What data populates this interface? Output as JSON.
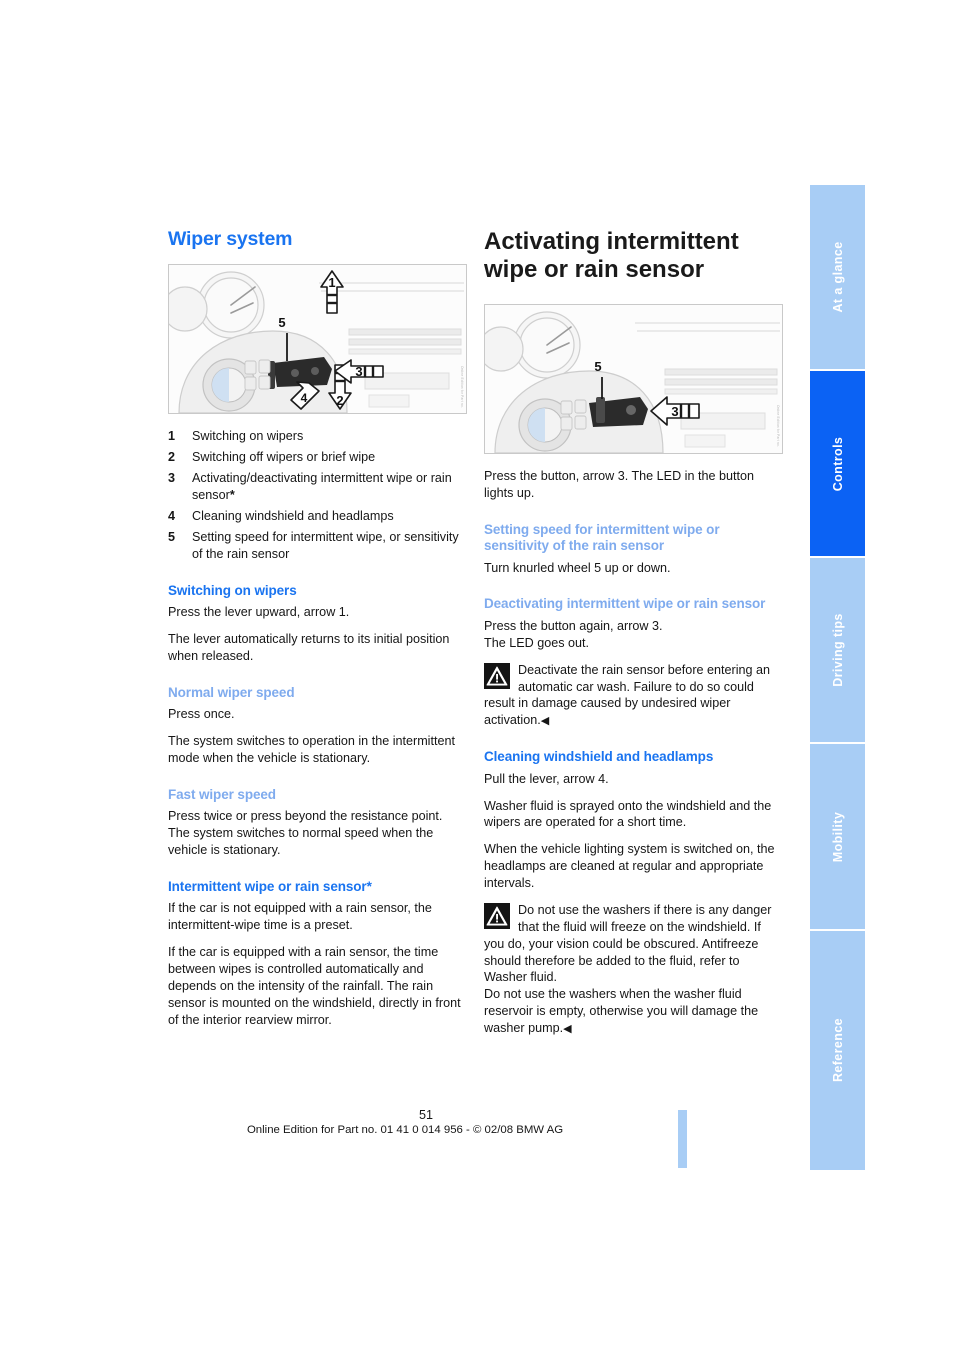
{
  "document": {
    "page_number": "51",
    "footer_line": "Online Edition for Part no. 01 41 0 014 956 - © 02/08 BMW AG"
  },
  "tabs": [
    {
      "label": "At a glance",
      "active": false
    },
    {
      "label": "Controls",
      "active": true
    },
    {
      "label": "Driving tips",
      "active": false
    },
    {
      "label": "Mobility",
      "active": false
    },
    {
      "label": "Reference",
      "active": false
    }
  ],
  "colors": {
    "heading_main": "#1a74f0",
    "heading_sub": "#7fabee",
    "tab_active": "#0b62f4",
    "tab_inactive": "#a8cdf5",
    "body_text": "#161616"
  },
  "left_column": {
    "title": "Wiper system",
    "figure": {
      "name": "wiper-stalk-illustration",
      "callouts": [
        "1",
        "2",
        "3",
        "4",
        "5"
      ],
      "watermark": "Online Edition for Part no."
    },
    "legend": [
      {
        "num": "1",
        "text": "Switching on wipers"
      },
      {
        "num": "2",
        "text": "Switching off wipers or brief wipe"
      },
      {
        "num": "3",
        "text": "Activating/deactivating intermittent wipe or rain sensor",
        "asterisk": "*"
      },
      {
        "num": "4",
        "text": "Cleaning windshield and headlamps"
      },
      {
        "num": "5",
        "text": "Setting speed for intermittent wipe, or sensitivity of the rain sensor"
      }
    ],
    "sections": [
      {
        "heading": "Switching on wipers",
        "level": "main",
        "paragraphs": [
          "Press the lever upward, arrow 1.",
          "The lever automatically returns to its initial position when released."
        ]
      },
      {
        "heading": "Normal wiper speed",
        "level": "sub",
        "paragraphs": [
          "Press once.",
          "The system switches to operation in the intermittent mode when the vehicle is stationary."
        ]
      },
      {
        "heading": "Fast wiper speed",
        "level": "sub",
        "paragraphs": [
          "Press twice or press beyond the resistance point.",
          "The system switches to normal speed when the vehicle is stationary."
        ]
      },
      {
        "heading": "Intermittent wipe or rain sensor*",
        "level": "main",
        "paragraphs": [
          "If the car is not equipped with a rain sensor, the intermittent-wipe time is a preset.",
          "If the car is equipped with a rain sensor, the time between wipes is controlled automatically and depends on the intensity of the rainfall. The rain sensor is mounted on the windshield, directly in front of the interior rearview mirror."
        ]
      }
    ]
  },
  "right_column": {
    "heading_top": "Activating intermittent wipe or rain sensor",
    "figure": {
      "name": "wiper-button-illustration",
      "callouts": [
        "3",
        "5"
      ],
      "watermark": "Online Edition for Part no."
    },
    "paragraph_top": "Press the button, arrow 3. The LED in the button lights up.",
    "sections": [
      {
        "heading": "Setting speed for intermittent wipe or sensitivity of the rain sensor",
        "level": "sub",
        "paragraphs": [
          "Turn knurled wheel 5 up or down."
        ]
      },
      {
        "heading": "Deactivating intermittent wipe or rain sensor",
        "level": "sub",
        "paragraphs": [
          "Press the button again, arrow 3.",
          "The LED goes out."
        ],
        "warning": "Deactivate the rain sensor before entering an automatic car wash. Failure to do so could result in damage caused by undesired wiper activation."
      },
      {
        "heading": "Cleaning windshield and headlamps",
        "level": "main",
        "paragraphs": [
          "Pull the lever, arrow 4.",
          "Washer fluid is sprayed onto the windshield and the wipers are operated for a short time.",
          "When the vehicle lighting system is switched on, the headlamps are cleaned at regular and appropriate intervals."
        ],
        "warning": "Do not use the washers if there is any danger that the fluid will freeze on the windshield. If you do, your vision could be obscured. Antifreeze should therefore be added to the fluid, refer to Washer fluid.\nDo not use the washers when the washer fluid reservoir is empty, otherwise you will damage the washer pump."
      }
    ],
    "warning_end_marker": "◀"
  }
}
